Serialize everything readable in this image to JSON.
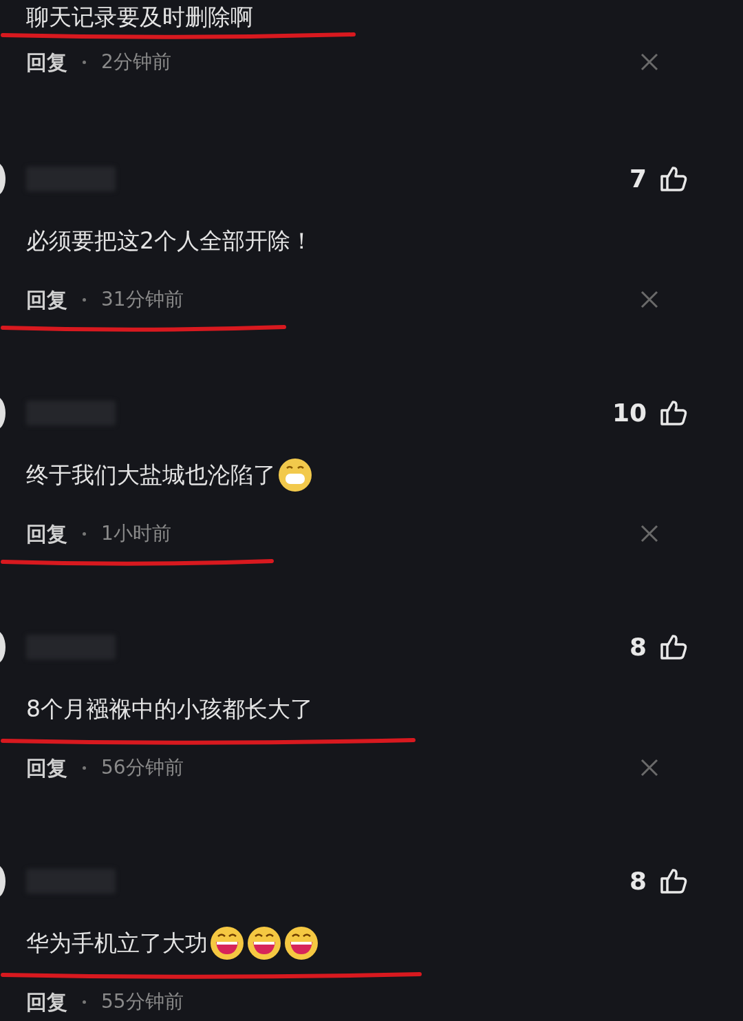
{
  "comments": [
    {
      "text": "聊天记录要及时删除啊",
      "reply": "回复",
      "time": "2分钟前",
      "text_underlined": true,
      "meta_underlined": false,
      "closable": true
    },
    {
      "likes": "7",
      "text": "必须要把这2个人全部开除！",
      "reply": "回复",
      "time": "31分钟前",
      "text_underlined": false,
      "meta_underlined": true,
      "closable": true
    },
    {
      "likes": "10",
      "text": "终于我们大盐城也沦陷了",
      "emojis": [
        {
          "kind": "grin"
        }
      ],
      "reply": "回复",
      "time": "1小时前",
      "text_underlined": false,
      "meta_underlined": true,
      "closable": true
    },
    {
      "likes": "8",
      "text": "8个月襁褓中的小孩都长大了",
      "reply": "回复",
      "time": "56分钟前",
      "text_underlined": true,
      "meta_underlined": false,
      "closable": true
    },
    {
      "likes": "8",
      "text": "华为手机立了大功",
      "emojis": [
        {
          "kind": "laugh"
        },
        {
          "kind": "laugh"
        },
        {
          "kind": "laugh"
        }
      ],
      "reply": "回复",
      "time": "55分钟前",
      "text_underlined": true,
      "meta_underlined": false,
      "closable": false
    }
  ]
}
